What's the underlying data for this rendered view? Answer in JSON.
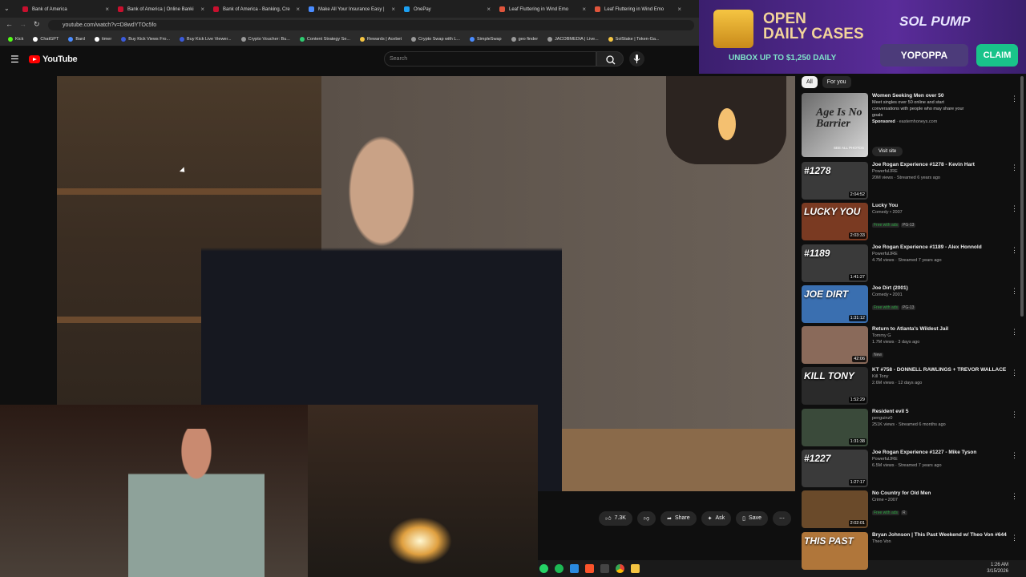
{
  "tabs": [
    {
      "title": "Bank of America",
      "color": "#c8102e"
    },
    {
      "title": "Bank of America | Online Banki",
      "color": "#c8102e"
    },
    {
      "title": "Bank of America - Banking, Cre",
      "color": "#c8102e"
    },
    {
      "title": "Make All Your Insurance Easy |",
      "color": "#4a8cff"
    },
    {
      "title": "OnePay",
      "color": "#1ca0f2"
    },
    {
      "title": "Leaf Fluttering in Wind Emo",
      "color": "#e0553c"
    },
    {
      "title": "Leaf Fluttering in Wind Emo",
      "color": "#e0553c"
    }
  ],
  "address": {
    "url": "youtube.com/watch?v=D8wdYTOc5fo"
  },
  "bookmarks": [
    {
      "label": "Kick",
      "color": "#53fc18"
    },
    {
      "label": "ChatGPT",
      "color": "#ffffff"
    },
    {
      "label": "Bard",
      "color": "#4a8cff"
    },
    {
      "label": "timer",
      "color": "#ffffff"
    },
    {
      "label": "Buy Kick Views Fro...",
      "color": "#3b5bdb"
    },
    {
      "label": "Buy Kick Live Viewer...",
      "color": "#3b5bdb"
    },
    {
      "label": "Crypto Voucher: Bu...",
      "color": "#999999"
    },
    {
      "label": "Content Strategy Se...",
      "color": "#2ecc71"
    },
    {
      "label": "Rewards | Acebet",
      "color": "#f5c542"
    },
    {
      "label": "Crypto Swap with L...",
      "color": "#999999"
    },
    {
      "label": "SimpleSwap",
      "color": "#4a8cff"
    },
    {
      "label": "geo finder",
      "color": "#999999"
    },
    {
      "label": "JACOBMEDIA | Live...",
      "color": "#999999"
    },
    {
      "label": "SolStake | Token-Ga...",
      "color": "#f5c542"
    }
  ],
  "youtube": {
    "logo": "YouTube",
    "search_placeholder": "Search"
  },
  "actions": {
    "likes": "7.3K",
    "share": "Share",
    "ask": "Ask",
    "save": "Save"
  },
  "ad": {
    "headline": "OPEN\nDAILY CASES",
    "subline": "UNBOX UP TO $1,250 DAILY",
    "brand": "SOL PUMP",
    "code": "YOPOPPA",
    "cta": "CLAIM"
  },
  "chips": [
    "All",
    "For you"
  ],
  "sponsored": {
    "title": "Women Seeking Men over 50",
    "desc": "Meet singles over 50 online and start conversations with people who may share your goals",
    "label": "Sponsored",
    "domain": "eastemhoneys.com",
    "thumb_text": "Age Is No Barrier",
    "thumb_sub": "SEE ALL PHOTOS",
    "button": "Visit site"
  },
  "videos": [
    {
      "title": "Joe Rogan Experience #1278 - Kevin Hart",
      "channel": "PowerfulJRE",
      "views": "20M views · Streamed 6 years ago",
      "duration": "2:04:52",
      "thumb": "#1278",
      "bg": "#3a3a3a"
    },
    {
      "title": "Lucky You",
      "channel": "Comedy • 2007",
      "views": "",
      "badges": [
        "Free with ads",
        "PG-13"
      ],
      "duration": "2:03:33",
      "thumb": "LUCKY YOU",
      "bg": "#7a3a22"
    },
    {
      "title": "Joe Rogan Experience #1189 - Alex Honnold",
      "channel": "PowerfulJRE",
      "views": "4.7M views · Streamed 7 years ago",
      "duration": "1:41:27",
      "thumb": "#1189",
      "bg": "#3a3a3a"
    },
    {
      "title": "Joe Dirt (2001)",
      "channel": "Comedy • 2001",
      "views": "",
      "badges": [
        "Free with ads",
        "PG-13"
      ],
      "duration": "1:31:12",
      "thumb": "JOE DIRT",
      "bg": "#3a6fb0"
    },
    {
      "title": "Return to Atlanta's Wildest Jail",
      "channel": "Tommy G",
      "views": "1.7M views · 3 days ago",
      "badges": [
        "New"
      ],
      "duration": "42:06",
      "thumb": "",
      "bg": "#8a6a5a"
    },
    {
      "title": "KT #758 - DONNELL RAWLINGS + TREVOR WALLACE",
      "channel": "Kill Tony",
      "views": "2.6M views · 12 days ago",
      "duration": "1:52:29",
      "thumb": "KILL TONY",
      "bg": "#2a2a2a"
    },
    {
      "title": "Resident evil 5",
      "channel": "penguinz0",
      "views": "251K views · Streamed 6 months ago",
      "duration": "1:31:38",
      "thumb": "",
      "bg": "#3a4a3a"
    },
    {
      "title": "Joe Rogan Experience #1227 - Mike Tyson",
      "channel": "PowerfulJRE",
      "views": "6.5M views · Streamed 7 years ago",
      "duration": "1:27:17",
      "thumb": "#1227",
      "bg": "#3a3a3a"
    },
    {
      "title": "No Country for Old Men",
      "channel": "Crime • 2007",
      "views": "",
      "badges": [
        "Free with ads",
        "R"
      ],
      "duration": "2:02:01",
      "thumb": "",
      "bg": "#6a4a2a"
    },
    {
      "title": "Bryan Johnson | This Past Weekend w/ Theo Von #644",
      "channel": "Theo Von",
      "views": "",
      "duration": "",
      "thumb": "THIS PAST",
      "bg": "#b0763a"
    }
  ],
  "clock": {
    "time": "1:26 AM",
    "date": "3/15/2026"
  }
}
